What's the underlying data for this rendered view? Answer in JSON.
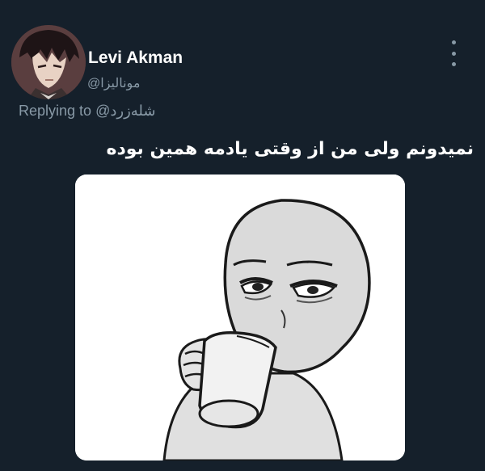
{
  "tweet": {
    "author": {
      "display_name": "Levi Akman",
      "handle": "@مونالیزا"
    },
    "reply": {
      "prefix": "Replying to",
      "mention": "@شله‌زرد"
    },
    "text": "نمیدونم ولی من از وقتی یادمه همین بوده",
    "media": {
      "description_icon": "meme-face-drinking-icon"
    },
    "menu_icon": "more-vertical-icon"
  },
  "colors": {
    "background": "#15202b",
    "secondary_text": "#8899a6",
    "primary_text": "#ffffff"
  }
}
